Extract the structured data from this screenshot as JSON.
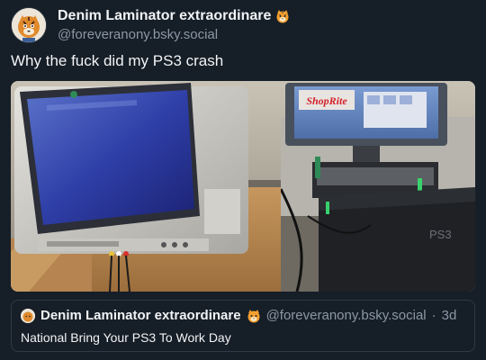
{
  "post": {
    "display_name": "Denim Laminator extraordinare",
    "handle": "@foreveranony.bsky.social",
    "text": "Why the fuck did my PS3 crash",
    "avatar_icon": "tiger-avatar-icon",
    "name_emoji": "tiger-face-icon"
  },
  "photo": {
    "screen_text": "ShopRite",
    "console_label": "PS3"
  },
  "quote": {
    "display_name": "Denim Laminator extraordinare",
    "handle": "@foreveranony.bsky.social",
    "separator": "·",
    "time": "3d",
    "text": "National Bring Your PS3 To Work Day"
  }
}
